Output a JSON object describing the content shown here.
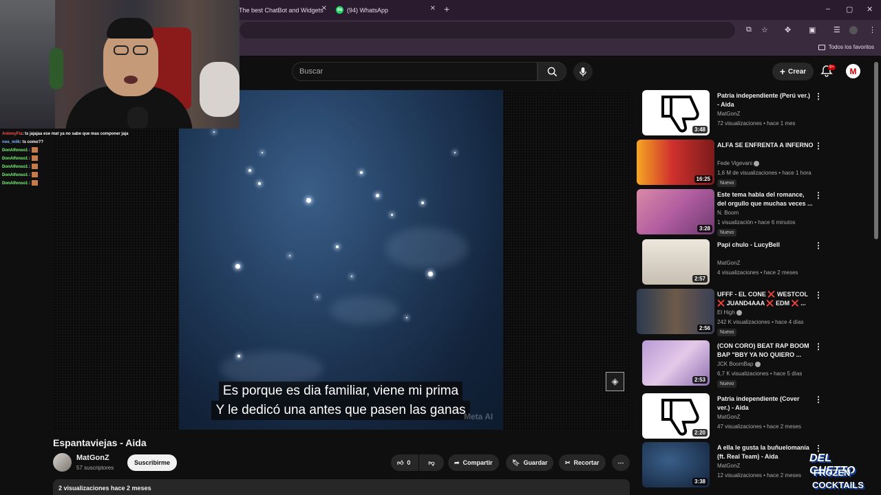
{
  "browser": {
    "tabs": [
      {
        "label": "The best ChatBot and Widgets"
      },
      {
        "label": "(94) WhatsApp",
        "badge": "94"
      }
    ],
    "bookmarks_folder": "Todos los favoritos"
  },
  "header": {
    "search_placeholder": "Buscar",
    "create_label": "Crear",
    "notif_badge": "9+",
    "avatar_letter": "M"
  },
  "stream": {
    "chat": [
      {
        "user": "AntonyFla",
        "text": ": ts jajajaa ese mat ya no sabe que mas componer jaja",
        "color": "red"
      },
      {
        "user": "noe_milk",
        "text": ": ts como??",
        "color": "blue"
      },
      {
        "user": "DonAlfonso1",
        "text": ":",
        "color": "green"
      },
      {
        "user": "DonAlfonso1",
        "text": ":",
        "color": "green"
      },
      {
        "user": "DonAlfonso1",
        "text": ":",
        "color": "green"
      },
      {
        "user": "DonAlfonso1",
        "text": ":",
        "color": "green"
      },
      {
        "user": "DonAlfonso1",
        "text": ":",
        "color": "green"
      }
    ],
    "watermark": [
      "DEL GHETTO",
      "FROZEN",
      "COCKTAILS"
    ]
  },
  "video": {
    "subtitles": [
      "Es porque es dia familiar, viene mi prima",
      "Y le dedicó una antes que pasen las ganas"
    ],
    "overlay_text": "Meta AI",
    "title": "Espantaviejas - Aida",
    "channel": "MatGonZ",
    "subscribers": "57 suscriptores",
    "subscribe_label": "Suscribirme",
    "likes": "0",
    "share_label": "Compartir",
    "save_label": "Guardar",
    "clip_label": "Recortar",
    "views_date": "2 visualizaciones  hace 2 meses"
  },
  "recommendations": [
    {
      "title": "Patria independiente (Perú ver.) - Aida",
      "channel": "MatGonZ",
      "meta": "72 visualizaciones • hace 1 mes",
      "duration": "3:48",
      "thumb": "dislike",
      "nuevo": ""
    },
    {
      "title": "ALFA SE ENFRENTA A INFERNO",
      "channel": "Fede Vigevani",
      "meta": "1,6 M de visualizaciones • hace 1 hora",
      "duration": "16:25",
      "thumb": "red",
      "nuevo": "Nuevo",
      "verified": true
    },
    {
      "title": "Este tema habla del romance, del orgullo que muchas veces ...",
      "channel": "N. Boom",
      "meta": "1 visualización • hace 6 minutos",
      "duration": "3:28",
      "thumb": "pink",
      "nuevo": "Nuevo"
    },
    {
      "title": "Papi chulo - LucyBell",
      "channel": "MatGonZ",
      "meta": "4 visualizaciones • hace 2 meses",
      "duration": "2:57",
      "thumb": "room",
      "nuevo": ""
    },
    {
      "title": "UFFF - EL CONE ❌ WESTCOL ❌ JUAND4AAA ❌ EDM ❌ ...",
      "channel": "El High",
      "meta": "242 K visualizaciones • hace 4 días",
      "duration": "2:56",
      "thumb": "people",
      "nuevo": "Nuevo",
      "verified": true
    },
    {
      "title": "(CON CORO) BEAT RAP BOOM BAP \"BBY YA NO QUIERO ...",
      "channel": "JCK BoomBap",
      "meta": "6,7 K visualizaciones • hace 5 días",
      "duration": "2:53",
      "thumb": "purple",
      "nuevo": "Nuevo",
      "verified": true
    },
    {
      "title": "Patria independiente (Cover ver.) - Aida",
      "channel": "MatGonZ",
      "meta": "47 visualizaciones • hace 2 meses",
      "duration": "2:20",
      "thumb": "dislike",
      "nuevo": ""
    },
    {
      "title": "A ella le gusta la buñuelomanía (ft.  Real Team) - Aida",
      "channel": "MatGonZ",
      "meta": "12 visualizaciones • hace 2 meses",
      "duration": "3:38",
      "thumb": "sky",
      "nuevo": ""
    }
  ]
}
